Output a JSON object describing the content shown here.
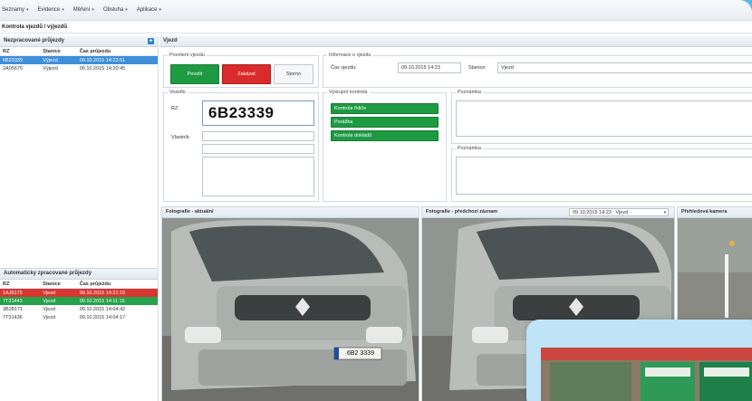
{
  "menu": [
    {
      "label": "Seznamy"
    },
    {
      "label": "Evidence"
    },
    {
      "label": "Měření"
    },
    {
      "label": "Obsluha"
    },
    {
      "label": "Aplikace"
    }
  ],
  "page_title": "Kontrola vjezdů / výjezdů",
  "unprocessed": {
    "title": "Nezpracované průjezdy",
    "columns": [
      "RZ",
      "Stanice",
      "Čas průjezdu"
    ],
    "rows": [
      {
        "rz": "6B23339",
        "station": "Výjezd",
        "time": "09.10.2015 14:23:51",
        "state": "selected"
      },
      {
        "rz": "2A05675",
        "station": "Výjezd",
        "time": "09.10.2015 14:20:45",
        "state": "normal"
      }
    ]
  },
  "auto_processed": {
    "title": "Automaticky zpracované průjezdy",
    "columns": [
      "RZ",
      "Stanice",
      "Čas průjezdu"
    ],
    "rows": [
      {
        "rz": "1AJ6175",
        "station": "Vjezd",
        "time": "09.10.2015 14:21:15",
        "state": "red"
      },
      {
        "rz": "7T21443",
        "station": "Vjezd",
        "time": "09.10.2015 14:11:15",
        "state": "green"
      },
      {
        "rz": "3B28171",
        "station": "Vjezd",
        "time": "09.10.2015 14:04:42",
        "state": "normal"
      },
      {
        "rz": "7T31436",
        "station": "Vjezd",
        "time": "09.10.2015 14:04:17",
        "state": "normal"
      }
    ]
  },
  "main": {
    "title": "Vjezd",
    "permit": {
      "legend": "Povolení vjezdu",
      "allow": "Povolit",
      "deny": "Zakázat",
      "cancel": "Storno"
    },
    "info": {
      "legend": "Informace o vjezdu",
      "time_label": "Čas vjezdu:",
      "time_value": "09.10.2015 14:23",
      "station_label": "Stanice:",
      "station_value": "Vjezd"
    },
    "vehicle": {
      "legend": "Vozidlo",
      "rz_label": "RZ:",
      "plate": "6B23339",
      "owner_label": "Vlastník:"
    },
    "exit_check": {
      "legend": "Výstupní kontrola",
      "buttons": [
        "Kontrola řidiče",
        "Porážka",
        "Kontrola dokladů"
      ]
    },
    "request_legend": "Poznámka",
    "note_legend": "Poznámka"
  },
  "photos": {
    "current": {
      "title": "Fotografie - aktuální",
      "plate_text": "6B2 3339"
    },
    "previous": {
      "title": "Fotografie - předchozí záznam",
      "select_value": "09.10.2015 14:23 : Vjezd"
    },
    "overview": {
      "title": "Přehledová kamera"
    }
  },
  "colors": {
    "accent_blue": "#3d8fd9",
    "success_green": "#1e9a43",
    "danger_red": "#d92b2b"
  }
}
